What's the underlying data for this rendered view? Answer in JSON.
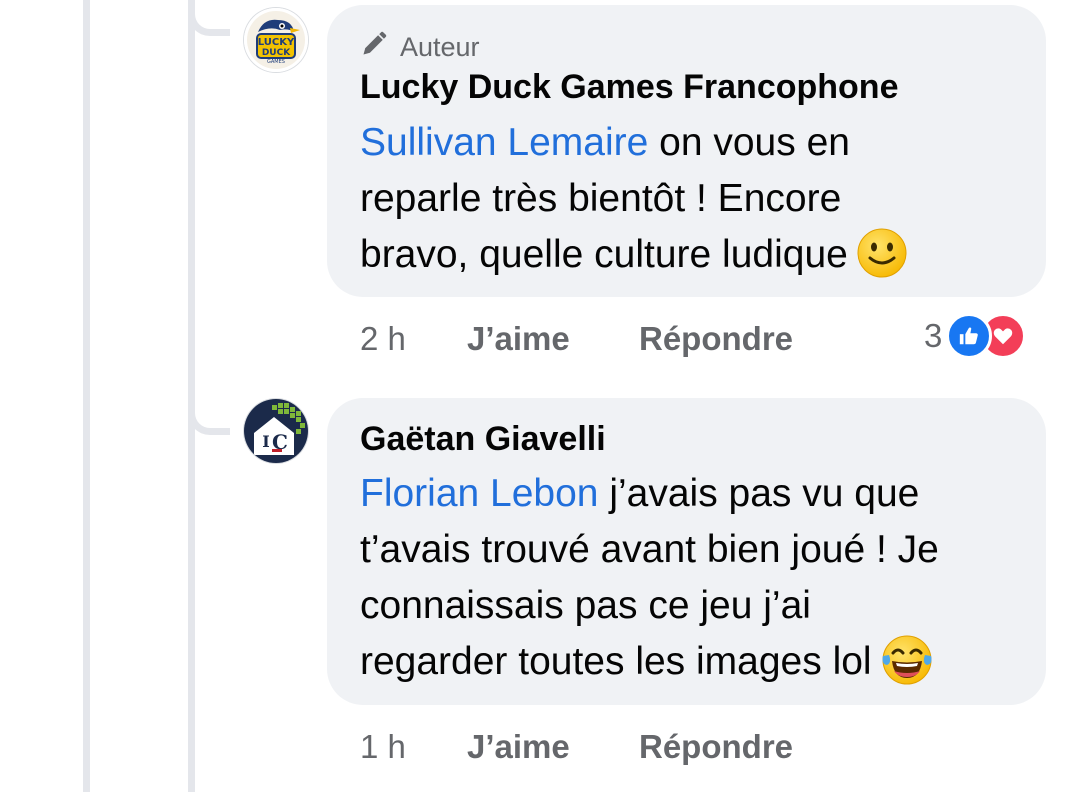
{
  "comments": [
    {
      "avatar_icon": "lucky-duck-logo-icon",
      "badge_icon": "pencil-icon",
      "badge_label": "Auteur",
      "author": "Lucky Duck Games Francophone",
      "mention": "Sullivan Lemaire",
      "text_line1": " on vous en",
      "text_line2": "reparle très bientôt ! Encore",
      "text_line3": "bravo, quelle culture ludique",
      "emoji": "slightly-smiling-face-icon",
      "time": "2 h",
      "like_label": "J’aime",
      "reply_label": "Répondre",
      "reaction_count": "3",
      "reaction_icons": [
        "like-reaction-icon",
        "love-reaction-icon"
      ]
    },
    {
      "avatar_icon": "ic-logo-icon",
      "author": "Gaëtan Giavelli",
      "mention": "Florian Lebon",
      "text_line1": " j’avais pas vu que",
      "text_line2": "t’avais trouvé avant bien joué ! Je",
      "text_line3": "connaissais pas ce jeu j’ai",
      "text_line4": "regarder toutes les images lol",
      "emoji": "tears-of-joy-face-icon",
      "time": "1 h",
      "like_label": "J’aime",
      "reply_label": "Répondre"
    }
  ],
  "colors": {
    "mention": "#216fdb",
    "bubble": "#f0f2f5",
    "secondary_text": "#65676b",
    "like_blue": "#1877f2",
    "love_red": "#f33e58"
  }
}
